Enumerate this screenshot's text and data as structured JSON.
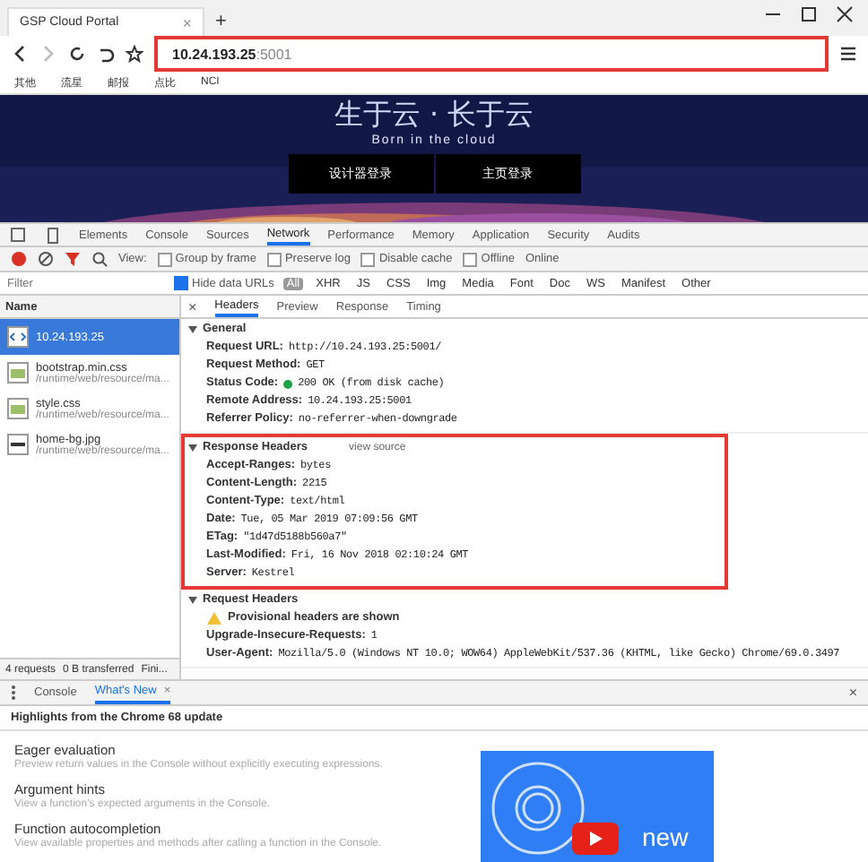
{
  "browser": {
    "tab_title": "GSP Cloud Portal",
    "tab_close": "×",
    "new_tab": "+",
    "url_host": "10.24.193.25",
    "url_port": ":5001",
    "bookmarks": [
      "其他",
      "流星",
      "邮报",
      "点比",
      "NCI"
    ]
  },
  "hero": {
    "title": "生于云 · 长于云",
    "subtitle": "Born in the cloud",
    "buttons": [
      "设计器登录",
      "主页登录"
    ]
  },
  "devtools": {
    "tabs": [
      {
        "label": "Elements",
        "selected": false
      },
      {
        "label": "Console",
        "selected": false
      },
      {
        "label": "Sources",
        "selected": false
      },
      {
        "label": "Network",
        "selected": true
      },
      {
        "label": "Performance",
        "selected": false
      },
      {
        "label": "Memory",
        "selected": false
      },
      {
        "label": "Application",
        "selected": false
      },
      {
        "label": "Security",
        "selected": false
      },
      {
        "label": "Audits",
        "selected": false
      }
    ],
    "toolbar": {
      "view_label": "View:",
      "options": [
        {
          "label": "Group by frame",
          "checked": false
        },
        {
          "label": "Preserve log",
          "checked": false
        },
        {
          "label": "Disable cache",
          "checked": false
        },
        {
          "label": "Offline",
          "checked": false
        }
      ],
      "throttle": "Online"
    },
    "filter": {
      "placeholder": "Filter",
      "hide_data_urls": {
        "label": "Hide data URLs",
        "checked": true
      },
      "types": [
        {
          "label": "All",
          "selected": true
        },
        {
          "label": "XHR",
          "selected": false
        },
        {
          "label": "JS",
          "selected": false
        },
        {
          "label": "CSS",
          "selected": false
        },
        {
          "label": "Img",
          "selected": false
        },
        {
          "label": "Media",
          "selected": false
        },
        {
          "label": "Font",
          "selected": false
        },
        {
          "label": "Doc",
          "selected": false
        },
        {
          "label": "WS",
          "selected": false
        },
        {
          "label": "Manifest",
          "selected": false
        },
        {
          "label": "Other",
          "selected": false
        }
      ]
    },
    "name_header": "Name",
    "requests": [
      {
        "name": "10.24.193.25",
        "kind": "doc",
        "selected": true
      },
      {
        "name": "bootstrap.min.css",
        "path": "/runtime/web/resource/ma...",
        "kind": "css",
        "selected": false
      },
      {
        "name": "style.css",
        "path": "/runtime/web/resource/ma...",
        "kind": "css",
        "selected": false
      },
      {
        "name": "home-bg.jpg",
        "path": "/runtime/web/resource/ma...",
        "kind": "img",
        "selected": false
      }
    ],
    "status_bar": [
      "4 requests",
      "0 B transferred",
      "Fini..."
    ],
    "detail_close": "×",
    "detail_tabs": [
      {
        "label": "Headers",
        "selected": true
      },
      {
        "label": "Preview",
        "selected": false
      },
      {
        "label": "Response",
        "selected": false
      },
      {
        "label": "Timing",
        "selected": false
      }
    ],
    "general": {
      "title": "General",
      "rows": [
        {
          "key": "Request URL:",
          "value": "http://10.24.193.25:5001/"
        },
        {
          "key": "Request Method:",
          "value": "GET"
        },
        {
          "key": "Status Code:",
          "value": "200 OK (from disk cache)",
          "color": "#1ea446"
        },
        {
          "key": "Remote Address:",
          "value": "10.24.193.25:5001"
        },
        {
          "key": "Referrer Policy:",
          "value": "no-referrer-when-downgrade"
        }
      ]
    },
    "response_headers": {
      "title": "Response Headers",
      "link": "view source",
      "highlighted": true,
      "rows": [
        {
          "key": "Accept-Ranges:",
          "value": "bytes"
        },
        {
          "key": "Content-Length:",
          "value": "2215"
        },
        {
          "key": "Content-Type:",
          "value": "text/html"
        },
        {
          "key": "Date:",
          "value": "Tue, 05 Mar 2019 07:09:56 GMT"
        },
        {
          "key": "ETag:",
          "value": "\"1d47d5188b560a7\""
        },
        {
          "key": "Last-Modified:",
          "value": "Fri, 16 Nov 2018 02:10:24 GMT"
        },
        {
          "key": "Server:",
          "value": "Kestrel"
        }
      ]
    },
    "request_headers": {
      "title": "Request Headers",
      "warning": "Provisional headers are shown",
      "rows": [
        {
          "key": "Upgrade-Insecure-Requests:",
          "value": "1"
        },
        {
          "key": "User-Agent:",
          "value": "Mozilla/5.0 (Windows NT 10.0; WOW64) AppleWebKit/537.36 (KHTML, like Gecko) Chrome/69.0.3497"
        }
      ]
    }
  },
  "drawer": {
    "tabs": [
      {
        "label": "Console",
        "selected": false,
        "closable": false
      },
      {
        "label": "What's New",
        "selected": true,
        "closable": true
      }
    ],
    "tab_close": "×",
    "close": "×",
    "heading": "Highlights from the Chrome 68 update",
    "items": [
      {
        "title": "Eager evaluation",
        "text": "Preview return values in the Console without explicitly executing expressions."
      },
      {
        "title": "Argument hints",
        "text": "View a function's expected arguments in the Console."
      },
      {
        "title": "Function autocompletion",
        "text": "View available properties and methods after calling a function in the Console."
      }
    ],
    "video_label": "new"
  }
}
